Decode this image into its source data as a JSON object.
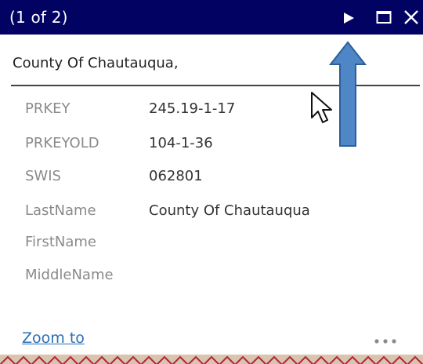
{
  "popup": {
    "title": "(1 of 2)",
    "header_name": "County Of Chautauqua,"
  },
  "title_bar": {
    "icons": {
      "next": "play-next-icon",
      "maximize": "maximize-icon",
      "close": "close-icon"
    }
  },
  "attributes": [
    {
      "key": "PRKEY",
      "value": "245.19-1-17"
    },
    {
      "key": "PRKEYOLD",
      "value": "104-1-36"
    },
    {
      "key": "SWIS",
      "value": "062801"
    },
    {
      "key": "LastName",
      "value": "County Of Chautauqua"
    },
    {
      "key": "FirstName",
      "value": ""
    },
    {
      "key": "MiddleName",
      "value": ""
    }
  ],
  "actions": {
    "zoom_to_label": "Zoom to",
    "more_icon": "more-dots-icon"
  },
  "colors": {
    "title_bar_bg": "#020262",
    "title_text": "#ffffff",
    "link": "#2a6fb5",
    "attr_key": "#8a8a8a",
    "attr_value": "#333333",
    "annotation_arrow": "#4f86c6"
  }
}
